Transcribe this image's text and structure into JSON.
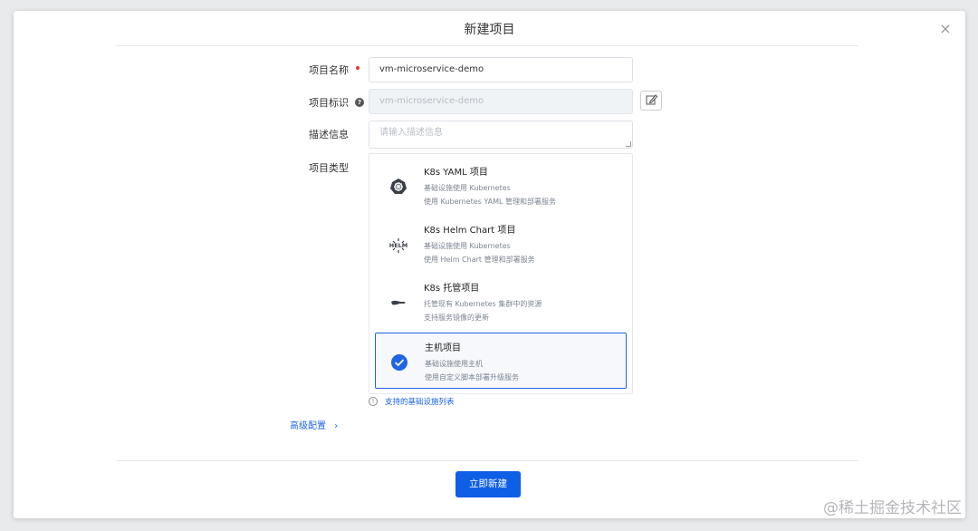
{
  "dialog": {
    "title": "新建项目",
    "close_symbol": "×"
  },
  "form": {
    "name_label": "项目名称",
    "name_value": "vm-microservice-demo",
    "id_label": "项目标识",
    "id_value": "vm-microservice-demo",
    "desc_label": "描述信息",
    "desc_placeholder": "请输入描述信息",
    "type_label": "项目类型"
  },
  "project_types": [
    {
      "name": "K8s YAML 项目",
      "line1": "基础设施使用 Kubernetes",
      "line2": "使用 Kubernetes YAML 管理和部署服务",
      "icon": "kubernetes-icon",
      "selected": false
    },
    {
      "name": "K8s Helm Chart 项目",
      "line1": "基础设施使用 Kubernetes",
      "line2": "使用 Helm Chart 管理和部署服务",
      "icon": "helm-icon",
      "selected": false
    },
    {
      "name": "K8s 托管项目",
      "line1": "托管现有 Kubernetes 集群中的资源",
      "line2": "支持服务镜像的更新",
      "icon": "hand-icon",
      "selected": false
    },
    {
      "name": "主机项目",
      "line1": "基础设施使用主机",
      "line2": "使用自定义脚本部署升级服务",
      "icon": "check-circle-icon",
      "selected": true
    }
  ],
  "info_link": "支持的基础设施列表",
  "advanced_link": "高级配置",
  "advanced_chevron": "›",
  "submit_label": "立即新建",
  "watermark": "@稀土掘金技术社区",
  "colors": {
    "accent": "#0f5ee6",
    "required": "#e53935"
  }
}
